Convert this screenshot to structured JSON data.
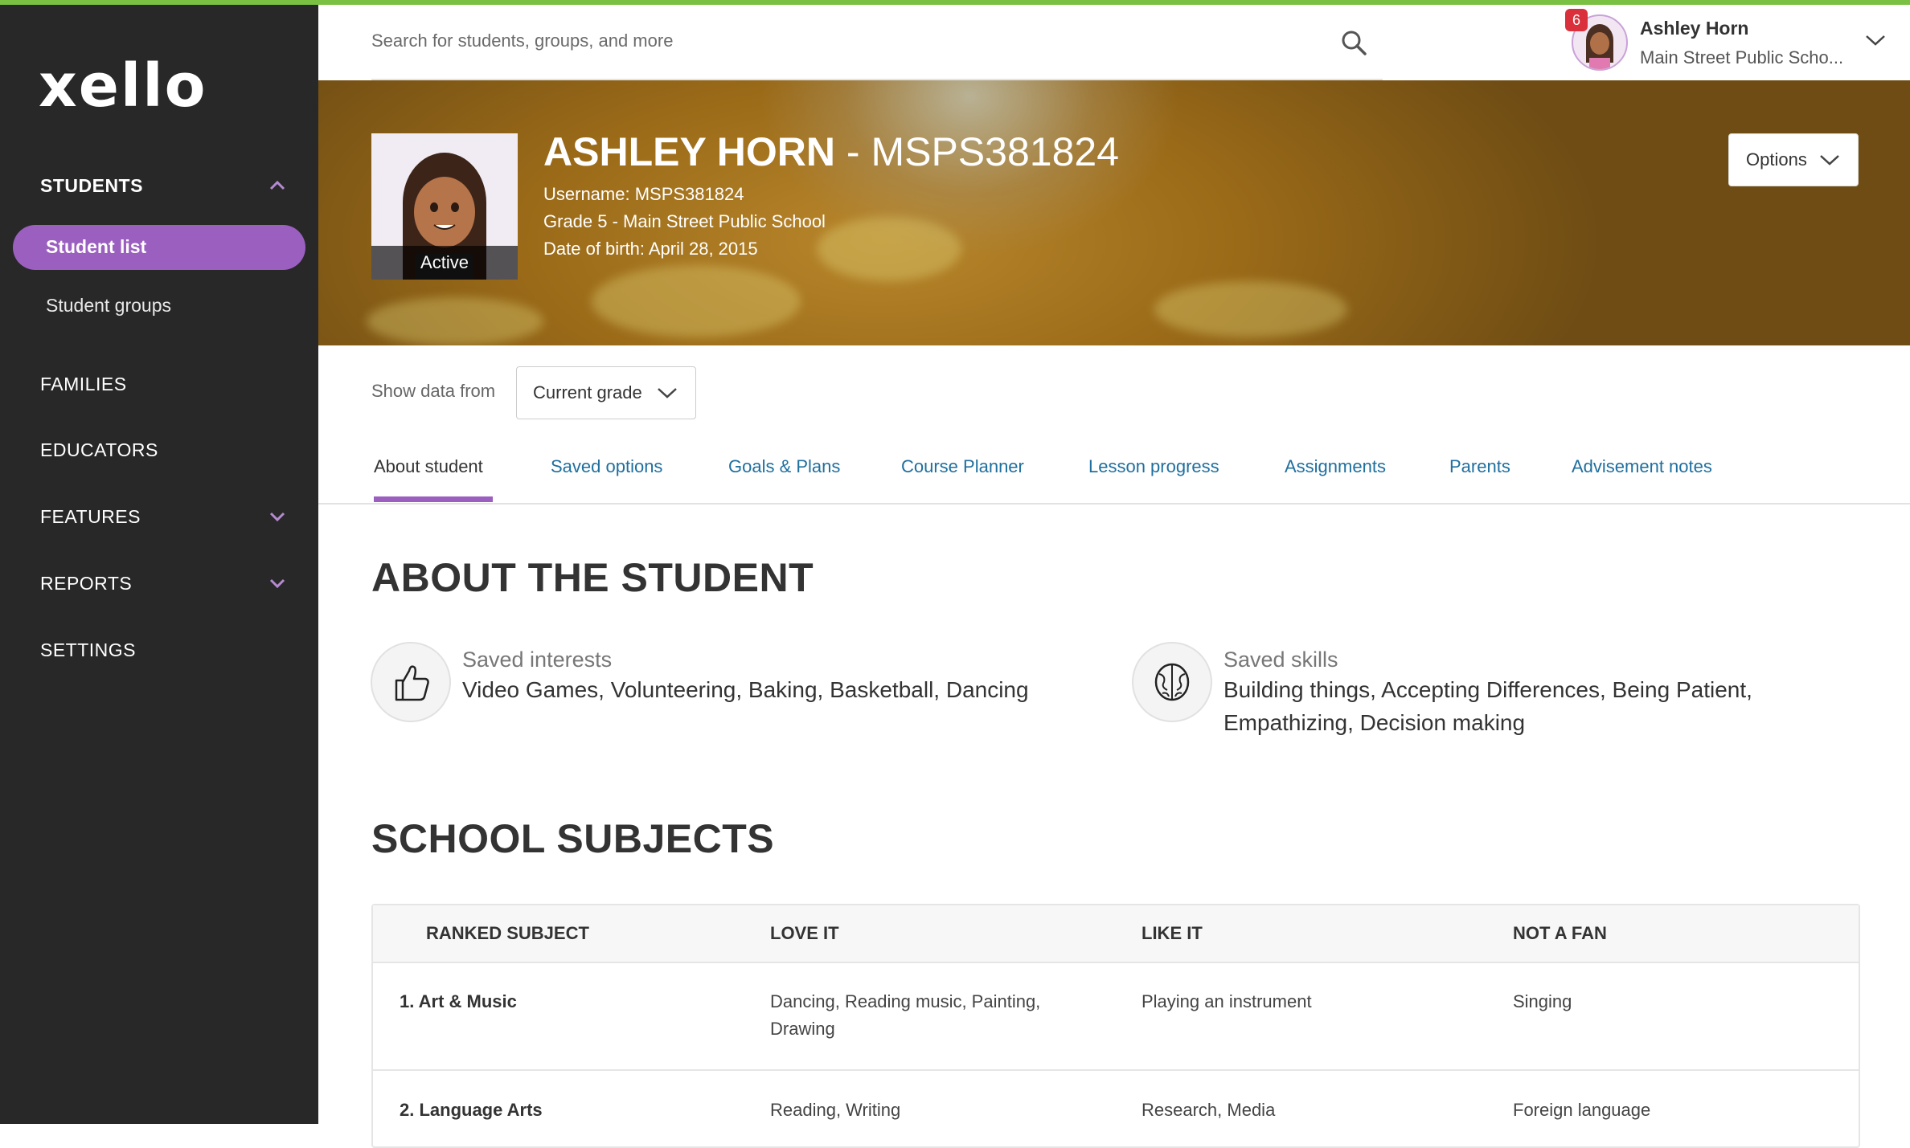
{
  "brand": {
    "logo": "xello",
    "accent": "#9b5fc0",
    "topline": "#7ac143"
  },
  "sidebar": {
    "students": "STUDENTS",
    "student_list": "Student list",
    "student_groups": "Student groups",
    "families": "FAMILIES",
    "educators": "EDUCATORS",
    "features": "FEATURES",
    "reports": "REPORTS",
    "settings": "SETTINGS"
  },
  "header": {
    "search_placeholder": "Search for students, groups, and more",
    "notification_count": "6",
    "user_name": "Ashley Horn",
    "user_school": "Main Street Public Scho..."
  },
  "student": {
    "name": "ASHLEY HORN",
    "separator": " - ",
    "id": "MSPS381824",
    "status": "Active",
    "username": "Username: MSPS381824",
    "grade": "Grade 5 - Main Street Public School",
    "dob": "Date of birth: April 28, 2015"
  },
  "options_label": "Options",
  "filter": {
    "label": "Show data from",
    "value": "Current grade"
  },
  "tabs": [
    {
      "label": "About student"
    },
    {
      "label": "Saved options"
    },
    {
      "label": "Goals & Plans"
    },
    {
      "label": "Course Planner"
    },
    {
      "label": "Lesson progress"
    },
    {
      "label": "Assignments"
    },
    {
      "label": "Parents"
    },
    {
      "label": "Advisement notes"
    }
  ],
  "about": {
    "heading": "ABOUT THE STUDENT",
    "interests_label": "Saved interests",
    "interests_value": "Video Games, Volunteering, Baking, Basketball, Dancing",
    "skills_label": "Saved skills",
    "skills_line1": "Building things, Accepting Differences, Being Patient,",
    "skills_line2": "Empathizing, Decision making"
  },
  "subjects": {
    "heading": "SCHOOL SUBJECTS",
    "columns": [
      "RANKED SUBJECT",
      "LOVE IT",
      "LIKE IT",
      "NOT A FAN"
    ],
    "rows": [
      {
        "subject": "1. Art & Music",
        "love1": "Dancing, Reading music, Painting,",
        "love2": "Drawing",
        "like": "Playing an instrument",
        "not": "Singing"
      },
      {
        "subject": "2. Language Arts",
        "love1": "Reading, Writing",
        "love2": "",
        "like": "Research, Media",
        "not": "Foreign language"
      }
    ]
  }
}
